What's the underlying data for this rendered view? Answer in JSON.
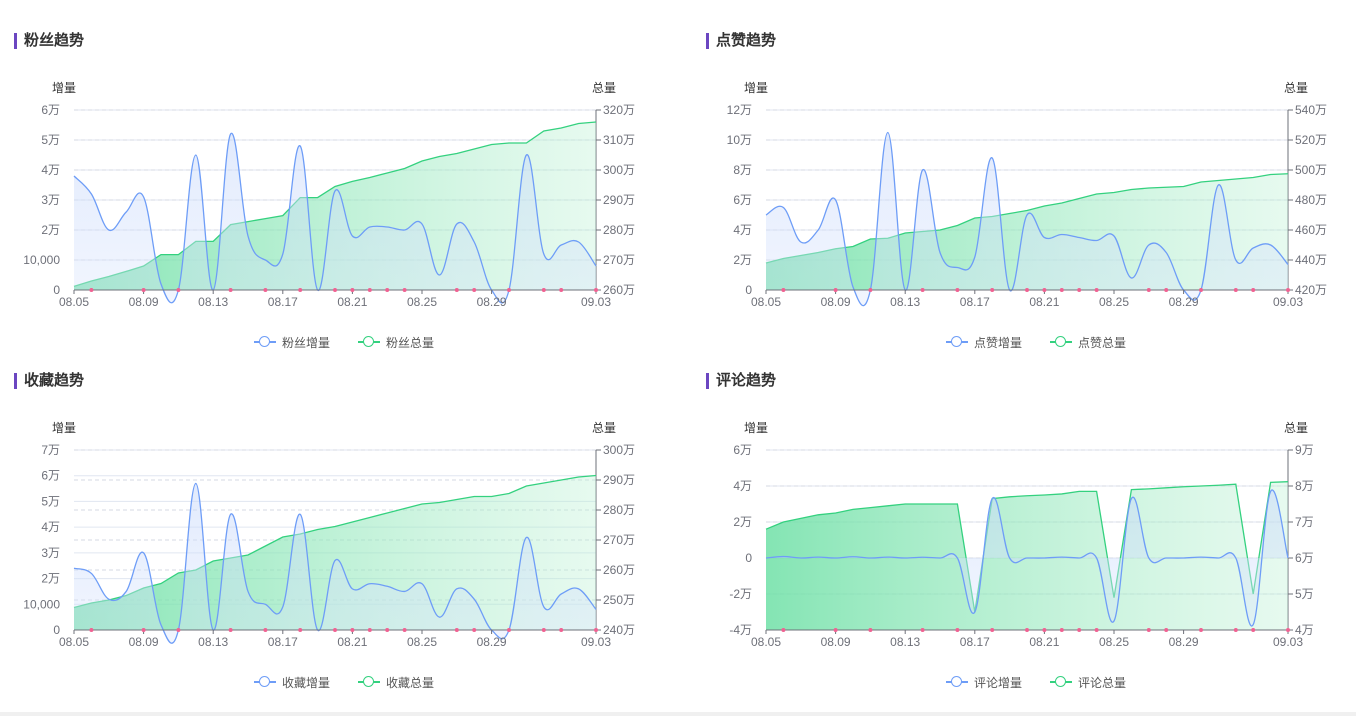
{
  "colors": {
    "increment": "#6e9df7",
    "total": "#34d17f",
    "marker": "#f06292",
    "axis": "#6e7079",
    "grid": "#e0e6f1",
    "title_bar": "#6b46c1"
  },
  "chart_data": [
    {
      "type": "line",
      "panel_title": "粉丝趋势",
      "left_axis_label": "增量",
      "right_axis_label": "总量",
      "left_ticks": [
        "0",
        "10,000",
        "2万",
        "3万",
        "4万",
        "5万",
        "6万"
      ],
      "right_ticks": [
        "260万",
        "270万",
        "280万",
        "290万",
        "300万",
        "310万",
        "320万"
      ],
      "x_ticks": [
        "08.05",
        "08.09",
        "08.13",
        "08.17",
        "08.21",
        "08.25",
        "08.29",
        "09.03"
      ],
      "ylim_left": [
        0,
        60000
      ],
      "ylim_right": [
        2600000,
        3200000
      ],
      "series": [
        {
          "name": "粉丝增量",
          "axis": "left",
          "values": [
            38000,
            32000,
            20000,
            26000,
            31000,
            2000,
            0,
            45000,
            0,
            52000,
            18000,
            10000,
            12000,
            48000,
            0,
            33000,
            18000,
            21000,
            21000,
            20000,
            22000,
            5000,
            22000,
            16000,
            0,
            0,
            45000,
            12000,
            15000,
            16000,
            8000
          ]
        },
        {
          "name": "粉丝总量",
          "axis": "right",
          "values": [
            2612000,
            2630000,
            2645000,
            2662000,
            2680000,
            2718000,
            2718000,
            2762000,
            2762000,
            2818000,
            2828000,
            2838000,
            2848000,
            2908000,
            2908000,
            2945000,
            2962000,
            2975000,
            2990000,
            3005000,
            3030000,
            3045000,
            3055000,
            3070000,
            3085000,
            3090000,
            3090000,
            3130000,
            3140000,
            3155000,
            3160000
          ]
        }
      ],
      "markers_at": [
        1,
        4,
        6,
        9,
        11,
        13,
        15,
        16,
        17,
        18,
        19,
        22,
        23,
        25,
        27,
        28,
        30
      ],
      "legend": [
        "粉丝增量",
        "粉丝总量"
      ]
    },
    {
      "type": "line",
      "panel_title": "点赞趋势",
      "left_axis_label": "增量",
      "right_axis_label": "总量",
      "left_ticks": [
        "0",
        "2万",
        "4万",
        "6万",
        "8万",
        "10万",
        "12万"
      ],
      "right_ticks": [
        "420万",
        "440万",
        "460万",
        "480万",
        "500万",
        "520万",
        "540万"
      ],
      "x_ticks": [
        "08.05",
        "08.09",
        "08.13",
        "08.17",
        "08.21",
        "08.25",
        "08.29",
        "09.03"
      ],
      "ylim_left": [
        0,
        120000
      ],
      "ylim_right": [
        4200000,
        5400000
      ],
      "series": [
        {
          "name": "点赞增量",
          "axis": "left",
          "values": [
            50000,
            55000,
            32000,
            40000,
            60000,
            2000,
            0,
            105000,
            0,
            80000,
            25000,
            15000,
            22000,
            88000,
            0,
            50000,
            35000,
            37000,
            35000,
            33000,
            36000,
            8000,
            30000,
            25000,
            0,
            0,
            70000,
            20000,
            28000,
            30000,
            17000
          ]
        },
        {
          "name": "点赞总量",
          "axis": "right",
          "values": [
            4380000,
            4410000,
            4430000,
            4450000,
            4475000,
            4490000,
            4540000,
            4545000,
            4580000,
            4590000,
            4600000,
            4630000,
            4680000,
            4690000,
            4710000,
            4730000,
            4760000,
            4780000,
            4810000,
            4840000,
            4850000,
            4870000,
            4880000,
            4885000,
            4890000,
            4920000,
            4930000,
            4940000,
            4950000,
            4970000,
            4975000
          ]
        }
      ],
      "markers_at": [
        1,
        4,
        6,
        9,
        11,
        13,
        15,
        16,
        17,
        18,
        19,
        22,
        23,
        25,
        27,
        28,
        30
      ],
      "legend": [
        "点赞增量",
        "点赞总量"
      ]
    },
    {
      "type": "line",
      "panel_title": "收藏趋势",
      "left_axis_label": "增量",
      "right_axis_label": "总量",
      "left_ticks": [
        "0",
        "10,000",
        "2万",
        "3万",
        "4万",
        "5万",
        "6万",
        "7万"
      ],
      "right_ticks": [
        "240万",
        "250万",
        "260万",
        "270万",
        "280万",
        "290万",
        "300万"
      ],
      "x_ticks": [
        "08.05",
        "08.09",
        "08.13",
        "08.17",
        "08.21",
        "08.25",
        "08.29",
        "09.03"
      ],
      "ylim_left": [
        0,
        70000
      ],
      "ylim_right": [
        2400000,
        3000000
      ],
      "series": [
        {
          "name": "收藏增量",
          "axis": "left",
          "values": [
            24000,
            22000,
            12000,
            15000,
            30000,
            2000,
            0,
            57000,
            0,
            45000,
            15000,
            10000,
            9000,
            45000,
            0,
            27000,
            16000,
            18000,
            17000,
            15000,
            18000,
            5000,
            16000,
            12000,
            0,
            0,
            36000,
            9000,
            14000,
            16000,
            8000
          ]
        },
        {
          "name": "收藏总量",
          "axis": "right",
          "values": [
            2475000,
            2490000,
            2500000,
            2515000,
            2540000,
            2555000,
            2590000,
            2600000,
            2630000,
            2640000,
            2650000,
            2680000,
            2710000,
            2720000,
            2735000,
            2745000,
            2760000,
            2775000,
            2790000,
            2805000,
            2820000,
            2825000,
            2835000,
            2845000,
            2845000,
            2855000,
            2880000,
            2890000,
            2900000,
            2910000,
            2915000
          ]
        }
      ],
      "markers_at": [
        1,
        4,
        6,
        9,
        11,
        13,
        15,
        16,
        17,
        18,
        19,
        22,
        23,
        25,
        27,
        28,
        30
      ],
      "legend": [
        "收藏增量",
        "收藏总量"
      ]
    },
    {
      "type": "line",
      "panel_title": "评论趋势",
      "left_axis_label": "增量",
      "right_axis_label": "总量",
      "left_ticks": [
        "-4万",
        "-2万",
        "0",
        "2万",
        "4万",
        "6万"
      ],
      "right_ticks": [
        "4万",
        "5万",
        "6万",
        "7万",
        "8万",
        "9万"
      ],
      "x_ticks": [
        "08.05",
        "08.09",
        "08.13",
        "08.17",
        "08.21",
        "08.25",
        "08.29",
        "09.03"
      ],
      "ylim_left": [
        -40000,
        60000
      ],
      "ylim_right": [
        40000,
        90000
      ],
      "series": [
        {
          "name": "评论增量",
          "axis": "left",
          "values": [
            0,
            800,
            0,
            500,
            0,
            700,
            0,
            500,
            0,
            400,
            0,
            0,
            -30000,
            33000,
            0,
            0,
            0,
            500,
            0,
            0,
            -35000,
            33000,
            0,
            0,
            0,
            500,
            0,
            0,
            -37000,
            37000,
            0
          ]
        },
        {
          "name": "评论总量",
          "axis": "right",
          "values": [
            68000,
            70000,
            71000,
            72000,
            72500,
            73500,
            74000,
            74500,
            75000,
            75000,
            75000,
            75000,
            45000,
            76500,
            77000,
            77300,
            77500,
            77800,
            78500,
            78500,
            49000,
            79000,
            79200,
            79500,
            79800,
            80000,
            80200,
            80500,
            50000,
            81000,
            81200
          ]
        }
      ],
      "markers_at": [
        1,
        4,
        6,
        9,
        11,
        13,
        15,
        16,
        17,
        18,
        19,
        22,
        23,
        25,
        27,
        28,
        30
      ],
      "legend": [
        "评论增量",
        "评论总量"
      ]
    }
  ]
}
